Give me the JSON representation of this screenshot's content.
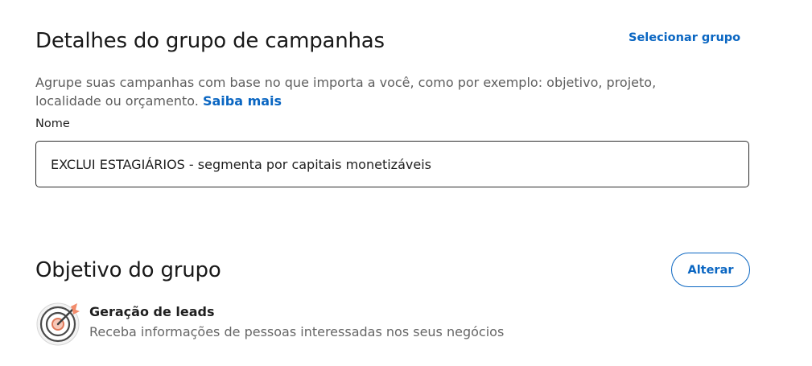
{
  "group_details": {
    "title": "Detalhes do grupo de campanhas",
    "select_group_link": "Selecionar grupo",
    "description": "Agrupe suas campanhas com base no que importa a você, como por exemplo: objetivo, projeto, localidade ou orçamento.",
    "learn_more_link": "Saiba mais",
    "name_label": "Nome",
    "name_value": "EXCLUI ESTAGIÁRIOS - segmenta por capitais monetizáveis"
  },
  "group_objective": {
    "title": "Objetivo do grupo",
    "change_button": "Alterar",
    "objective_icon": "target-icon",
    "objective_name": "Geração de leads",
    "objective_description": "Receba informações de pessoas interessadas nos seus negócios"
  },
  "colors": {
    "link": "#0a66c2",
    "text_primary": "#1f1f1f",
    "text_secondary": "#5e5e5e",
    "icon_accent": "#f28b6b"
  }
}
